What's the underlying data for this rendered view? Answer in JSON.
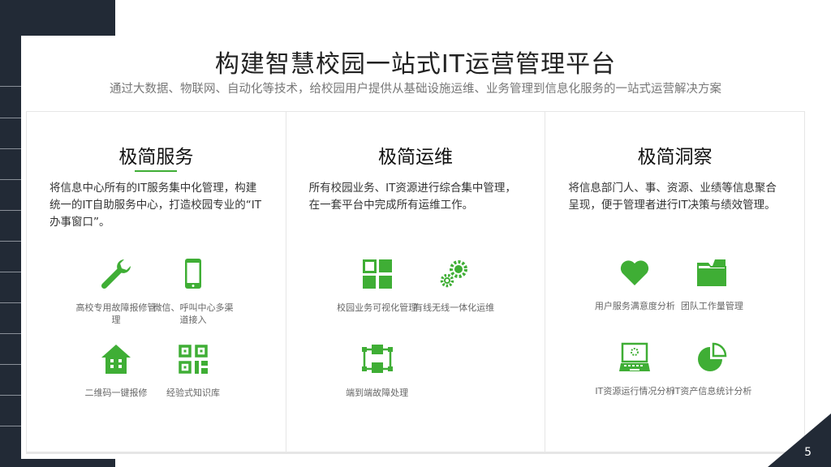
{
  "header": {
    "title": "构建智慧校园一站式IT运营管理平台",
    "subtitle": "通过大数据、物联网、自动化等技术，给校园用户提供从基础设施运维、业务管理到信息化服务的一站式运营解决方案"
  },
  "columns": [
    {
      "heading": "极简服务",
      "desc": "将信息中心所有的IT服务集中化管理，构建统一的IT自助服务中心，打造校园专业的“IT办事窗口”。",
      "items": [
        {
          "icon": "wrench-icon",
          "label": "高校专用故障报修管理"
        },
        {
          "icon": "mobile-phone-icon",
          "label": "微信、呼叫中心多渠道接入"
        },
        {
          "icon": "house-icon",
          "label": "二维码一键报修"
        },
        {
          "icon": "qr-code-icon",
          "label": "经验式知识库"
        }
      ]
    },
    {
      "heading": "极简运维",
      "desc": "所有校园业务、IT资源进行综合集中管理，在一套平台中完成所有运维工作。",
      "items": [
        {
          "icon": "grid-icon",
          "label": "校园业务可视化管理"
        },
        {
          "icon": "gears-icon",
          "label": "有线无线一体化运维"
        },
        {
          "icon": "network-nodes-icon",
          "label": "端到端故障处理"
        }
      ]
    },
    {
      "heading": "极简洞察",
      "desc": "将信息部门人、事、资源、业绩等信息聚合呈现，便于管理者进行IT决策与绩效管理。",
      "items": [
        {
          "icon": "heart-icon",
          "label": "用户服务满意度分析"
        },
        {
          "icon": "folder-icon",
          "label": "团队工作量管理"
        },
        {
          "icon": "laptop-icon",
          "label": "IT资源运行情况分析"
        },
        {
          "icon": "pie-chart-icon",
          "label": "IT资产信息统计分析"
        }
      ]
    }
  ],
  "page_number": "5",
  "colors": {
    "accent": "#3fae35",
    "dark": "#222a36"
  }
}
